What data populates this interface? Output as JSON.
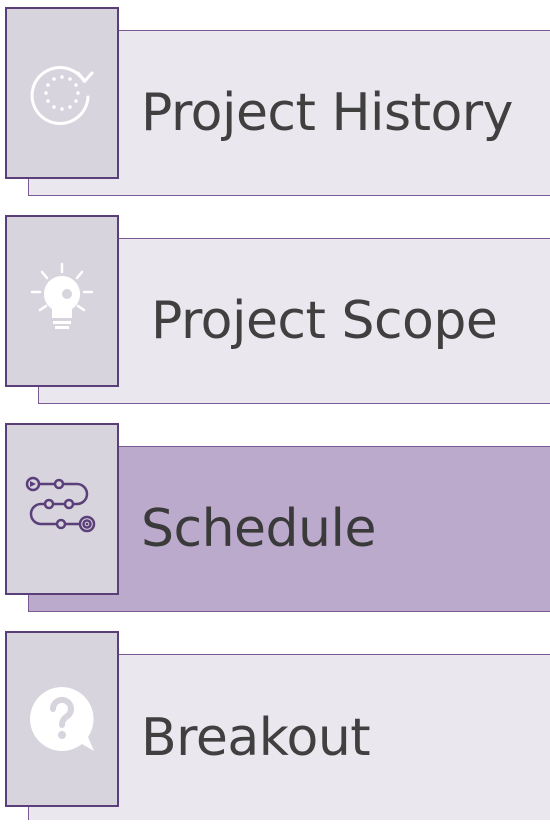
{
  "colors": {
    "panel_fill": "#eae8ee",
    "panel_active_fill": "#bcaacc",
    "icon_box_fill": "#d7d4de",
    "border": "#5b3f79",
    "text": "#404040"
  },
  "items": [
    {
      "label": "Project History",
      "icon": "history-icon",
      "active": false
    },
    {
      "label": "Project Scope",
      "icon": "lightbulb-gear-icon",
      "active": false
    },
    {
      "label": "Schedule",
      "icon": "roadmap-icon",
      "active": true
    },
    {
      "label": "Breakout",
      "icon": "question-bubble-icon",
      "active": false
    }
  ]
}
